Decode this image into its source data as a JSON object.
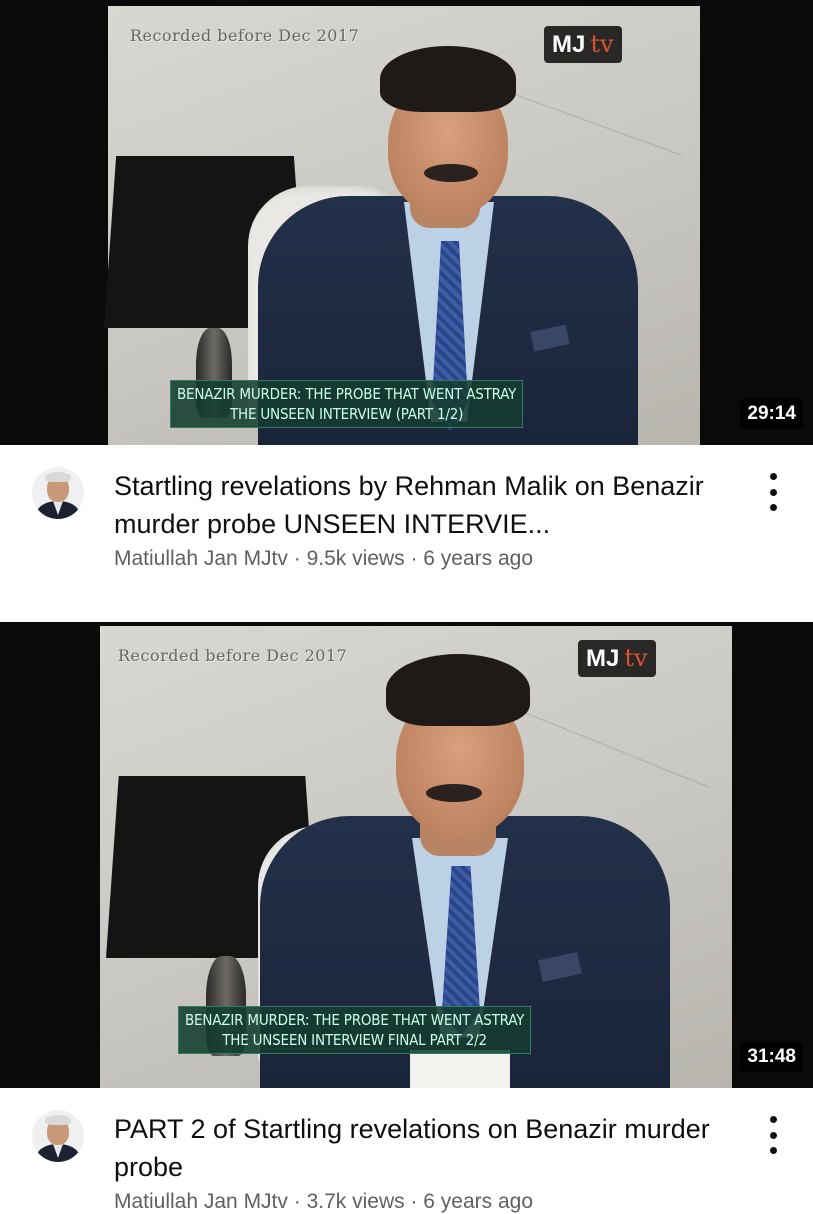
{
  "videos": [
    {
      "thumbnail": {
        "overlay_text": "Recorded before Dec 2017",
        "logo_mj": "MJ",
        "logo_tv": "tv",
        "caption_line1": "BENAZIR MURDER: THE PROBE THAT WENT ASTRAY",
        "caption_line2": "THE UNSEEN INTERVIEW (PART 1/2)",
        "duration": "29:14"
      },
      "title": "Startling revelations by Rehman Malik on Benazir murder probe UNSEEN INTERVIE...",
      "channel": "Matiullah Jan MJtv",
      "views": "9.5k views",
      "age": "6 years ago"
    },
    {
      "thumbnail": {
        "overlay_text": "Recorded before Dec 2017",
        "logo_mj": "MJ",
        "logo_tv": "tv",
        "caption_line1": "BENAZIR MURDER: THE PROBE THAT WENT ASTRAY",
        "caption_line2": "THE UNSEEN INTERVIEW FINAL PART 2/2",
        "duration": "31:48"
      },
      "title": "PART 2 of Startling revelations on Benazir murder probe",
      "channel": "Matiullah Jan MJtv",
      "views": "3.7k views",
      "age": "6 years ago"
    }
  ],
  "separator": " · ",
  "icons": {
    "more": "more-vert-icon",
    "avatar": "channel-avatar"
  },
  "colors": {
    "title": "#0f0f0f",
    "meta": "#606060",
    "duration_bg": "#000000",
    "caption_bg": "#143c30"
  }
}
